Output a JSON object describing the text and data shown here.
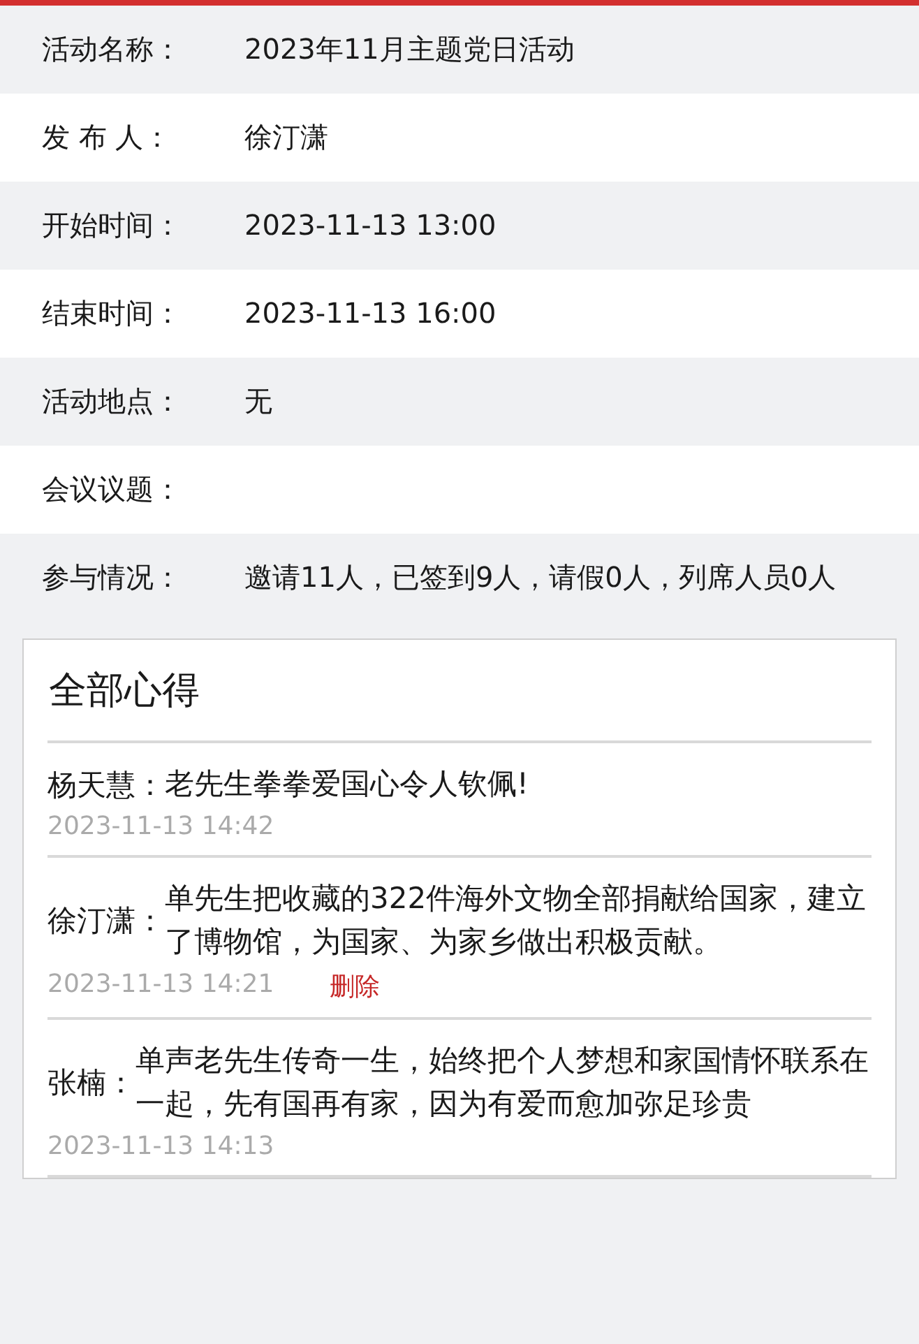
{
  "details": [
    {
      "label": "活动名称：",
      "value": "2023年11月主题党日活动"
    },
    {
      "label": "发 布 人：",
      "value": "徐汀潇"
    },
    {
      "label": "开始时间：",
      "value": "2023-11-13 13:00"
    },
    {
      "label": "结束时间：",
      "value": "2023-11-13 16:00"
    },
    {
      "label": "活动地点：",
      "value": "无"
    },
    {
      "label": "会议议题："
    },
    {
      "label": "参与情况：",
      "value": "邀请11人，已签到9人，请假0人，列席人员0人"
    }
  ],
  "comments_panel": {
    "title": "全部心得",
    "comments": [
      {
        "author": "杨天慧：",
        "text": "老先生拳拳爱国心令人钦佩!",
        "time": "2023-11-13 14:42"
      },
      {
        "author": "徐汀潇：",
        "text": "单先生把收藏的322件海外文物全部捐献给国家，建立了博物馆，为国家、为家乡做出积极贡献。",
        "time": "2023-11-13 14:21",
        "delete_label": "删除"
      },
      {
        "author": "张楠：",
        "text": "单声老先生传奇一生，始终把个人梦想和家国情怀联系在一起，先有国再有家，因为有爱而愈加弥足珍贵",
        "time": "2023-11-13 14:13"
      }
    ]
  }
}
